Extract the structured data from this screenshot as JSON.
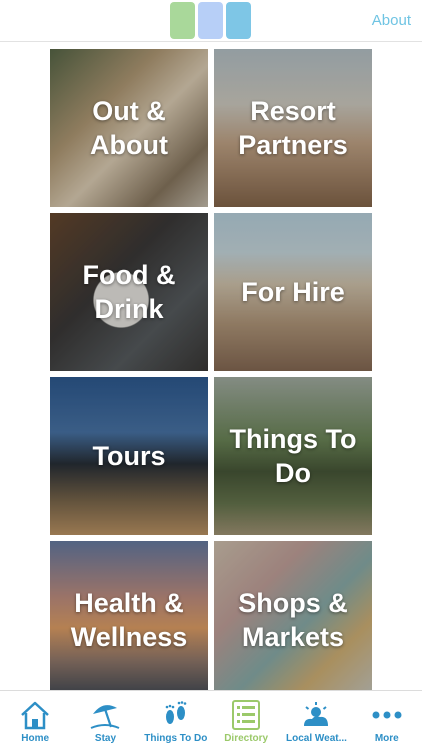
{
  "header": {
    "logo_colors": [
      "#a9d89a",
      "#b7cff7",
      "#7ec6e6"
    ],
    "about_label": "About"
  },
  "tiles": [
    {
      "label": "Out & About"
    },
    {
      "label": "Resort Partners"
    },
    {
      "label": "Food & Drink"
    },
    {
      "label": "For Hire"
    },
    {
      "label": "Tours"
    },
    {
      "label": "Things To Do"
    },
    {
      "label": "Health & Wellness"
    },
    {
      "label": "Shops & Markets"
    }
  ],
  "tabbar": {
    "items": [
      {
        "label": "Home",
        "icon": "house-icon"
      },
      {
        "label": "Stay",
        "icon": "beach-umbrella-icon"
      },
      {
        "label": "Things To Do",
        "icon": "footprints-icon"
      },
      {
        "label": "Directory",
        "icon": "directory-list-icon",
        "active": true
      },
      {
        "label": "Local Weat...",
        "icon": "weather-icon"
      },
      {
        "label": "More",
        "icon": "more-dots-icon"
      }
    ],
    "accent_color": "#2d8fc6",
    "active_color": "#9bc96a"
  }
}
